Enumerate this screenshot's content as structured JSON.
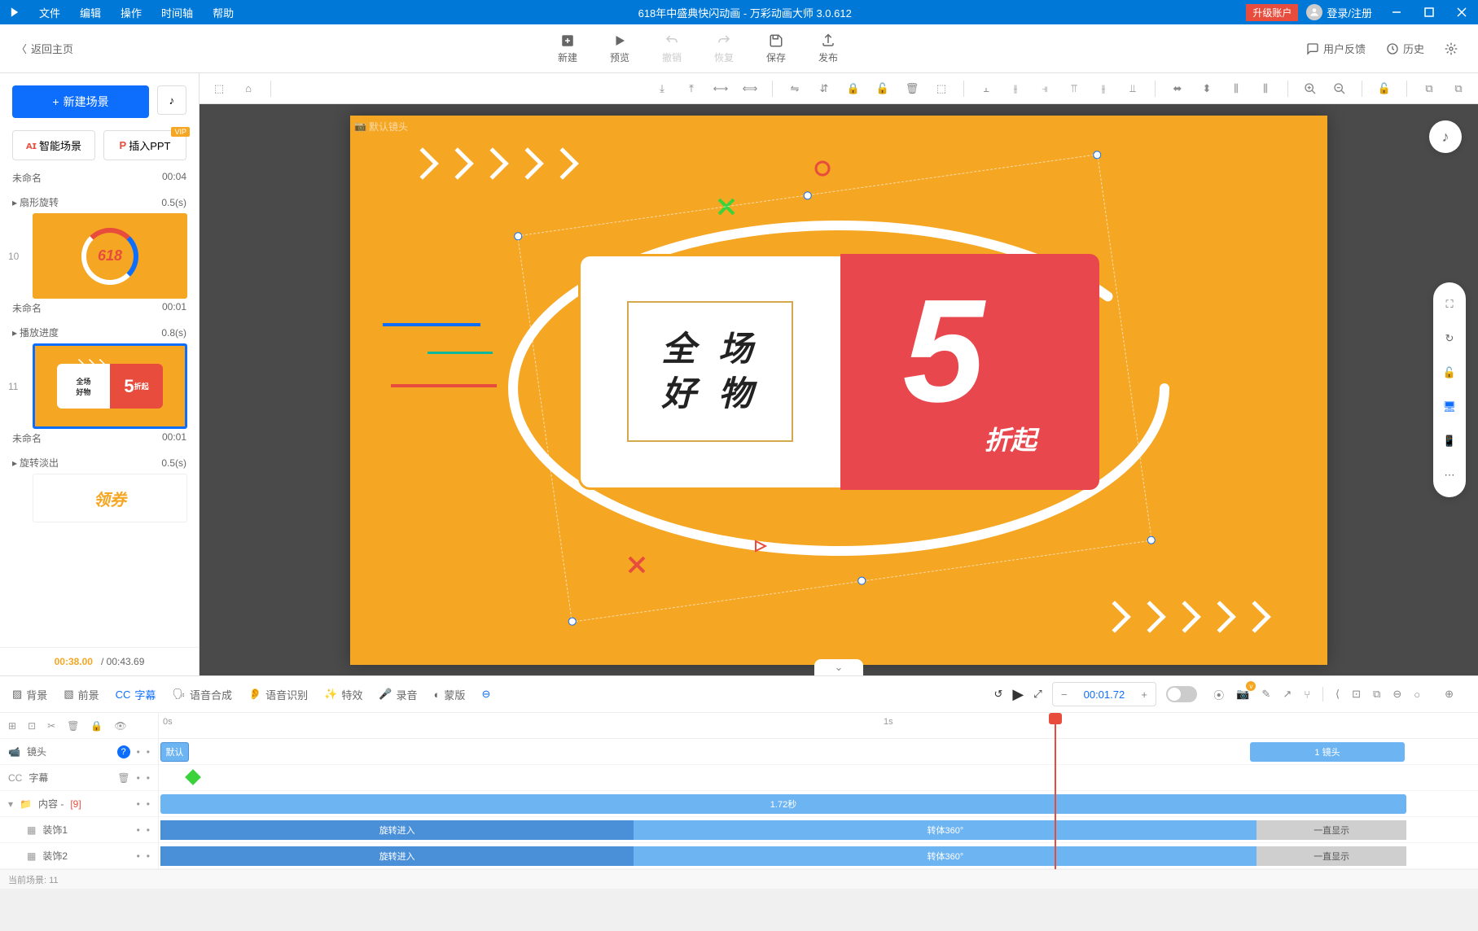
{
  "titlebar": {
    "menus": [
      "文件",
      "编辑",
      "操作",
      "时间轴",
      "帮助"
    ],
    "title": "618年中盛典快闪动画 - 万彩动画大师 3.0.612",
    "upgrade": "升级账户",
    "login": "登录/注册"
  },
  "toptool": {
    "back": "返回主页",
    "actions": [
      {
        "icon": "plus",
        "label": "新建"
      },
      {
        "icon": "play",
        "label": "预览"
      },
      {
        "icon": "undo",
        "label": "撤销",
        "disabled": true
      },
      {
        "icon": "redo",
        "label": "恢复",
        "disabled": true
      },
      {
        "icon": "save",
        "label": "保存"
      },
      {
        "icon": "publish",
        "label": "发布"
      }
    ],
    "right": [
      {
        "icon": "fb",
        "label": "用户反馈"
      },
      {
        "icon": "hist",
        "label": "历史"
      },
      {
        "icon": "set",
        "label": "设置"
      }
    ]
  },
  "left": {
    "new_scene": "新建场景",
    "smart": "智能场景",
    "ppt": "插入PPT",
    "scenes": [
      {
        "num": "",
        "name": "未命名",
        "time": "00:04",
        "trans": "扇形旋转",
        "trans_t": "0.5(s)"
      },
      {
        "num": "10",
        "name": "未命名",
        "time": "00:01",
        "trans": "播放进度",
        "trans_t": "0.8(s)"
      },
      {
        "num": "11",
        "name": "未命名",
        "time": "00:01",
        "trans": "旋转淡出",
        "trans_t": "0.5(s)",
        "selected": true
      }
    ],
    "coupon_thumb": {
      "left": "全场\n好物",
      "right": "5",
      "sub": "折起"
    },
    "thumb_next": "领券",
    "cur": "00:38.00",
    "total": "/ 00:43.69"
  },
  "canvas": {
    "cam_label": "默认镜头",
    "coupon": {
      "left_l1": "全 场",
      "left_l2": "好 物",
      "big": "5",
      "sub": "折起"
    }
  },
  "bottom": {
    "tabs": [
      {
        "icon": "bg",
        "label": "背景"
      },
      {
        "icon": "fg",
        "label": "前景"
      },
      {
        "icon": "cc",
        "label": "字幕",
        "active": true
      },
      {
        "icon": "tts",
        "label": "语音合成"
      },
      {
        "icon": "asr",
        "label": "语音识别"
      },
      {
        "icon": "fx",
        "label": "特效"
      },
      {
        "icon": "rec",
        "label": "录音"
      },
      {
        "icon": "mask",
        "label": "蒙版"
      }
    ],
    "time": "00:01.72",
    "ruler": {
      "t0": "0s",
      "t1": "1s"
    },
    "tracks": {
      "camera": {
        "label": "镜头",
        "default": "默认",
        "clip": "1 镜头"
      },
      "subtitle": {
        "label": "字幕"
      },
      "content": {
        "label": "内容 -",
        "count": "[9]",
        "clip": "1.72秒"
      },
      "deco1": {
        "label": "装饰1",
        "in": "旋转进入",
        "mid": "转体360°",
        "out": "一直显示"
      },
      "deco2": {
        "label": "装饰2",
        "in": "旋转进入",
        "mid": "转体360°",
        "out": "一直显示"
      }
    }
  },
  "status": {
    "scene": "当前场景: 11"
  }
}
